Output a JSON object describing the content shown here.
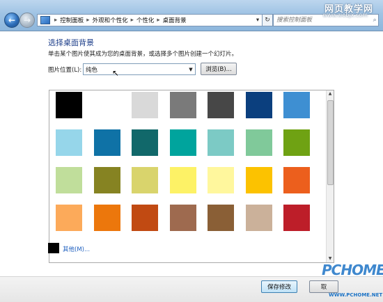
{
  "address_bar": {
    "breadcrumbs": [
      "控制面板",
      "外观和个性化",
      "个性化",
      "桌面背景"
    ],
    "separator": "▸"
  },
  "search": {
    "placeholder": "搜索控制面板"
  },
  "watermark": {
    "site": "网页教学网",
    "url": "www.webjx.com"
  },
  "main": {
    "heading": "选择桌面背景",
    "description": "单击某个图片使其成为您的桌面背景，或选择多个图片创建一个幻灯片。",
    "location_label": "图片位置(L):",
    "location_value": "纯色",
    "browse_label": "浏览(B)..."
  },
  "colors": [
    "#000000",
    "#ffffff",
    "#d9d9d9",
    "#7a7a7a",
    "#474747",
    "#0b3f7e",
    "#3e8fd2",
    "#96d6ea",
    "#0f72a6",
    "#11686a",
    "#00a49d",
    "#7ccac5",
    "#80c99a",
    "#6fa213",
    "#c0de9b",
    "#868322",
    "#d9d46c",
    "#fdf266",
    "#fff79d",
    "#fcc200",
    "#ec5f1d",
    "#fcaa5a",
    "#ec770c",
    "#c14a12",
    "#9e6a4f",
    "#8a5f36",
    "#cbb19a",
    "#bd1e29"
  ],
  "other": {
    "label": "其他(M)...",
    "swatch_color": "#000000"
  },
  "footer": {
    "save_label": "保存修改",
    "cancel_label": "取",
    "brand": "PCHOME",
    "brand_url": "WWW.PCHOME.NET"
  }
}
